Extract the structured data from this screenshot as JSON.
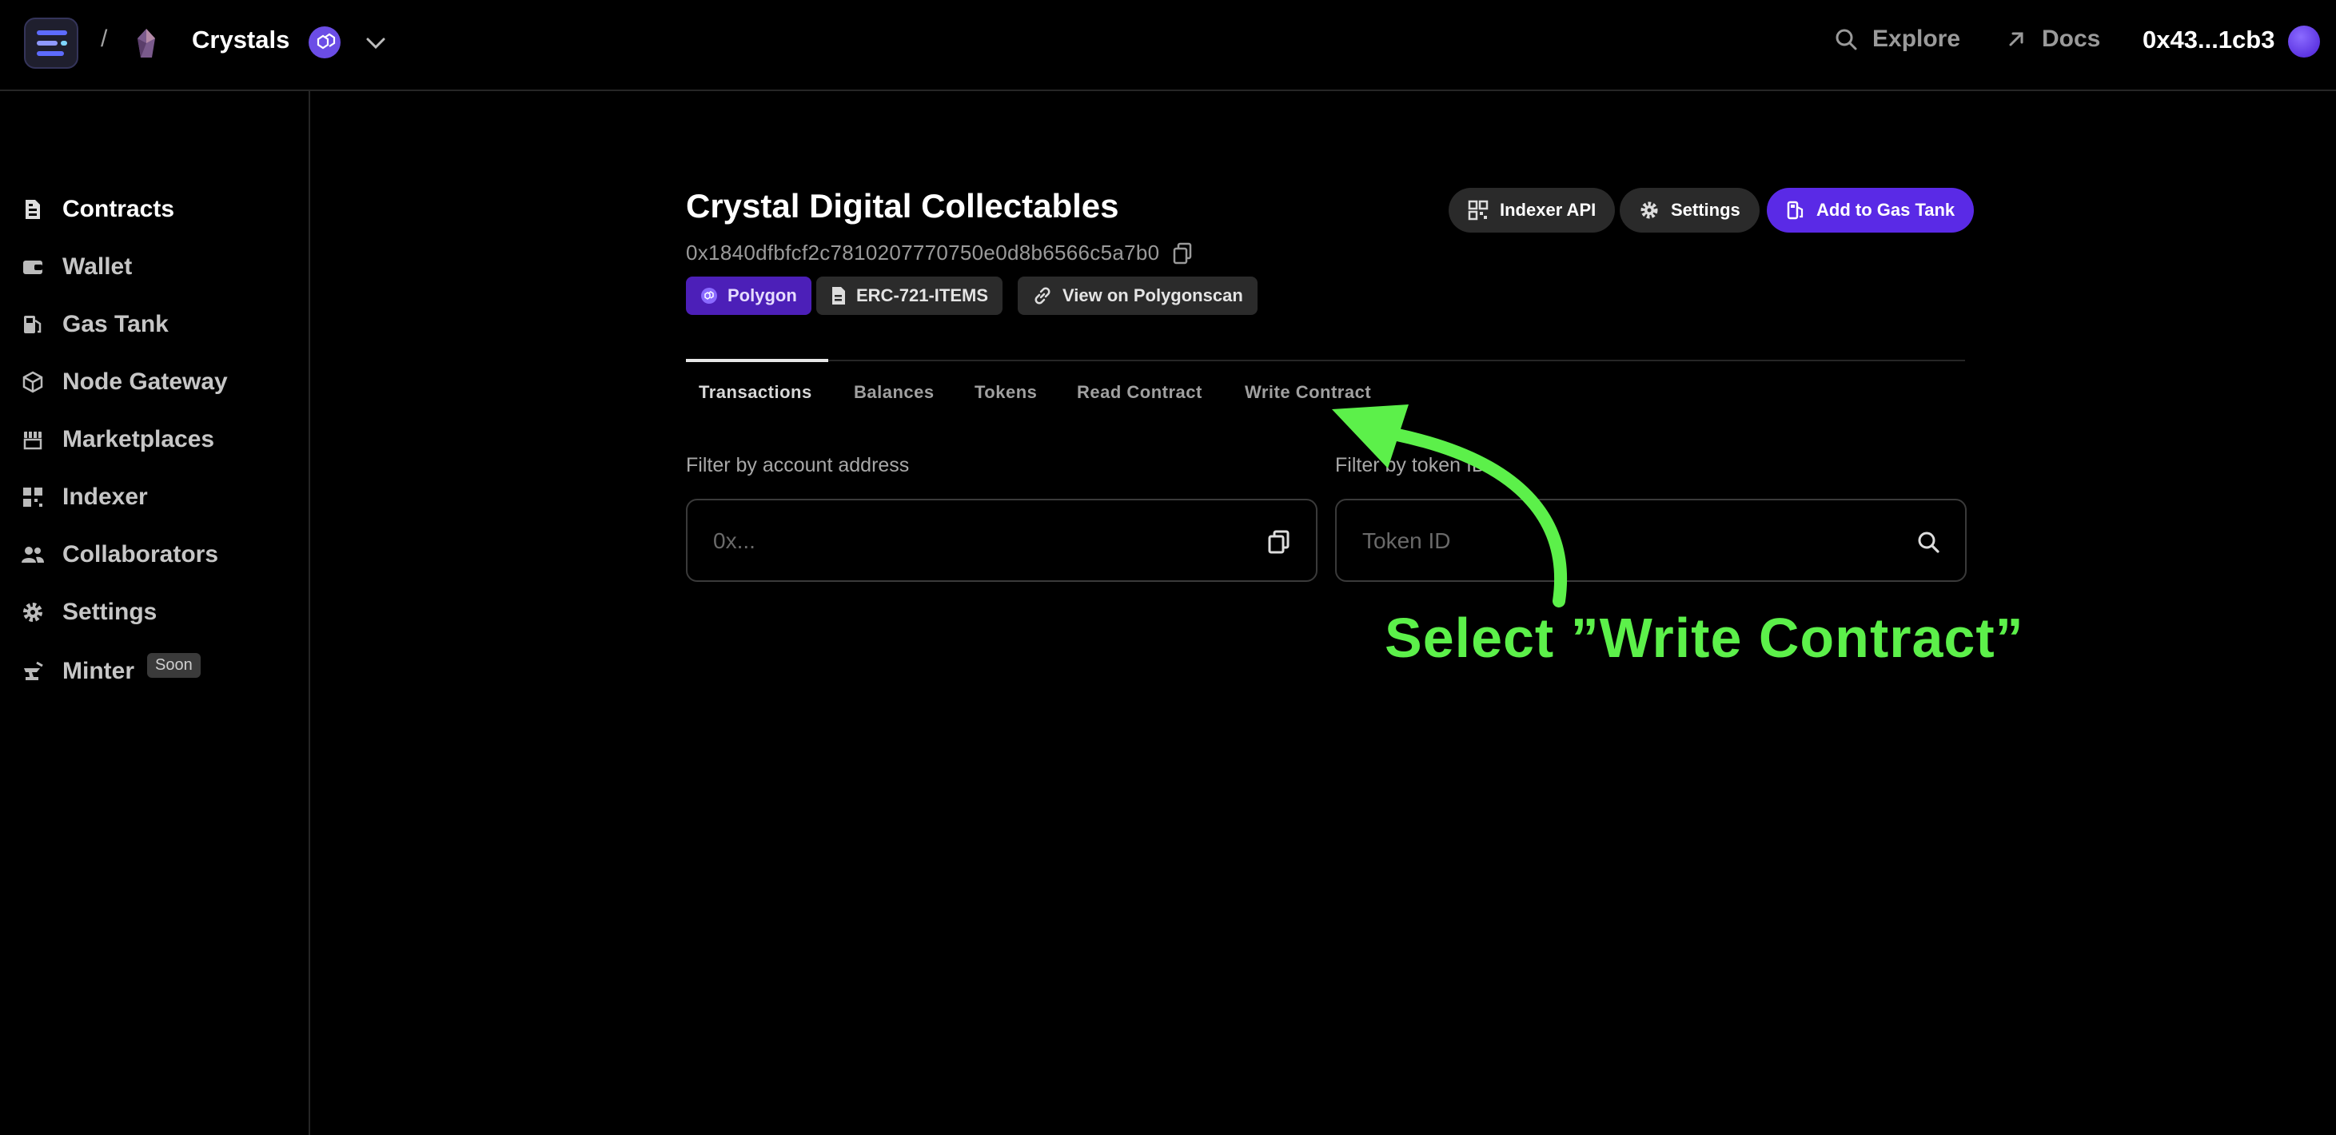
{
  "topbar": {
    "separator": "/",
    "project_name": "Crystals",
    "explore_label": "Explore",
    "docs_label": "Docs",
    "wallet_address": "0x43...1cb3"
  },
  "sidebar": {
    "items": [
      {
        "label": "Contracts",
        "icon": "contract-icon",
        "active": true
      },
      {
        "label": "Wallet",
        "icon": "wallet-icon"
      },
      {
        "label": "Gas Tank",
        "icon": "gas-pump-icon"
      },
      {
        "label": "Node Gateway",
        "icon": "cube-icon"
      },
      {
        "label": "Marketplaces",
        "icon": "store-icon"
      },
      {
        "label": "Indexer",
        "icon": "grid-icon"
      },
      {
        "label": "Collaborators",
        "icon": "users-icon"
      },
      {
        "label": "Settings",
        "icon": "gear-icon"
      },
      {
        "label": "Minter",
        "icon": "anvil-icon",
        "badge": "Soon"
      }
    ]
  },
  "contract": {
    "title": "Crystal Digital Collectables",
    "address": "0x1840dfbfcf2c7810207770750e0d8b6566c5a7b0",
    "chips": {
      "network": "Polygon",
      "standard": "ERC-721-ITEMS",
      "explorer": "View on Polygonscan"
    },
    "buttons": {
      "indexer_api": "Indexer API",
      "settings": "Settings",
      "add_to_gas_tank": "Add to Gas Tank"
    }
  },
  "tabs": [
    {
      "label": "Transactions",
      "active": true
    },
    {
      "label": "Balances"
    },
    {
      "label": "Tokens"
    },
    {
      "label": "Read Contract"
    },
    {
      "label": "Write Contract"
    }
  ],
  "filters": {
    "account": {
      "label": "Filter by account address",
      "placeholder": "0x..."
    },
    "token": {
      "label": "Filter by token ID",
      "placeholder": "Token ID"
    }
  },
  "annotation": {
    "text": "Select ”Write Contract”",
    "color": "#5cf04a"
  },
  "colors": {
    "background": "#000000",
    "accent_purple": "#5a2ae6",
    "annotation_green": "#5cf04a"
  }
}
